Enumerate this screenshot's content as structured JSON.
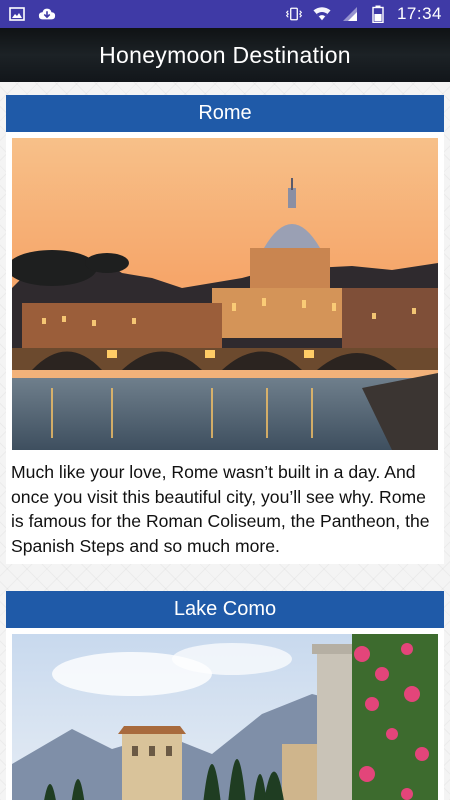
{
  "status_bar": {
    "time": "17:34",
    "left_icons": [
      "image-icon",
      "cloud-download-icon"
    ],
    "right_icons": [
      "vibrate-icon",
      "wifi-icon",
      "signal-icon",
      "battery-icon"
    ]
  },
  "app_bar": {
    "title": "Honeymoon Destination"
  },
  "destinations": [
    {
      "name": "Rome",
      "image_icon": "rome-vatican-sunset-photo",
      "description": "Much like your love, Rome wasn’t built in a day. And once you visit this beautiful city, you’ll see why. Rome is famous for the Roman Coliseum, the Pantheon, the Spanish Steps and so much more."
    },
    {
      "name": "Lake Como",
      "image_icon": "lake-como-villa-photo"
    }
  ],
  "colors": {
    "status_bar": "#3f3aa6",
    "section_header": "#1f5aa8",
    "app_bar": "#161b1f"
  }
}
